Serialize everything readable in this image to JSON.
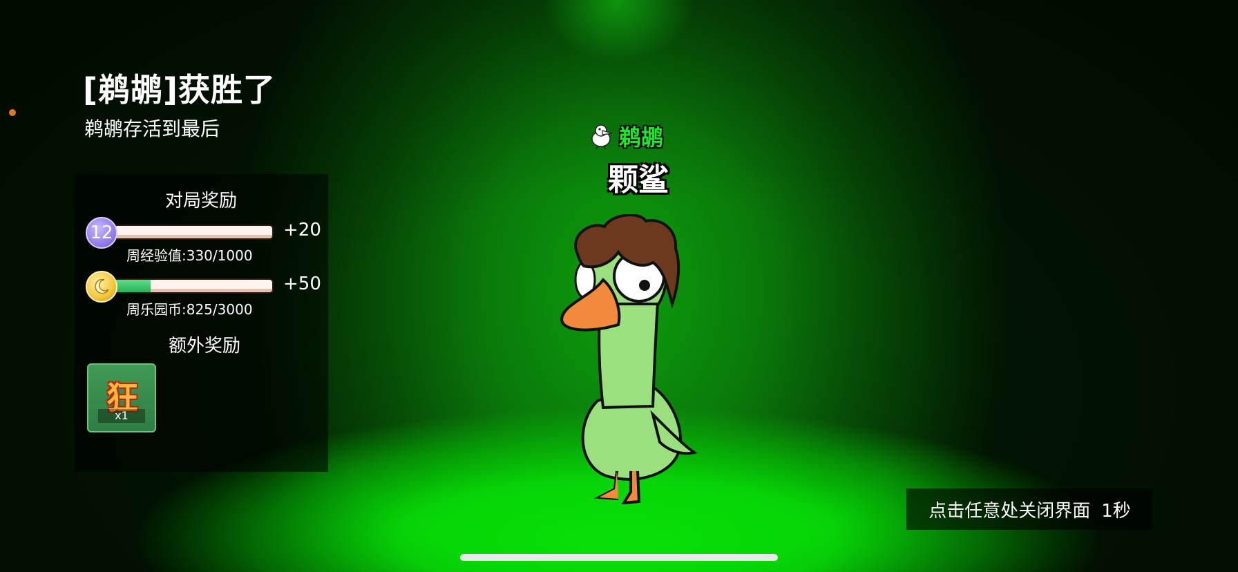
{
  "result": {
    "title": "[鹈鹕]获胜了",
    "subtitle": "鹈鹕存活到最后"
  },
  "rewards": {
    "match_title": "对局奖励",
    "level": {
      "icon": "level-badge-icon",
      "value": "12",
      "gain": "+20",
      "caption": "周经验值:330/1000",
      "progress": 0.0
    },
    "coins": {
      "icon": "coin-icon",
      "gain": "+50",
      "caption": "周乐园币:825/3000",
      "progress": 0.23
    },
    "extra_title": "额外奖励",
    "extra_item": {
      "icon": "kuang-token-icon",
      "glyph": "狂",
      "count": "x1"
    }
  },
  "winner": {
    "avatar_icon": "pelican-avatar-icon",
    "player_name": "鹈鹕",
    "role_name": "颗鲨"
  },
  "close_hint": {
    "text": "点击任意处关闭界面",
    "countdown": "1秒"
  },
  "colors": {
    "player_name": "#1ee82a",
    "bar_fill": "#24b25a",
    "spotlight": "#07e007"
  }
}
